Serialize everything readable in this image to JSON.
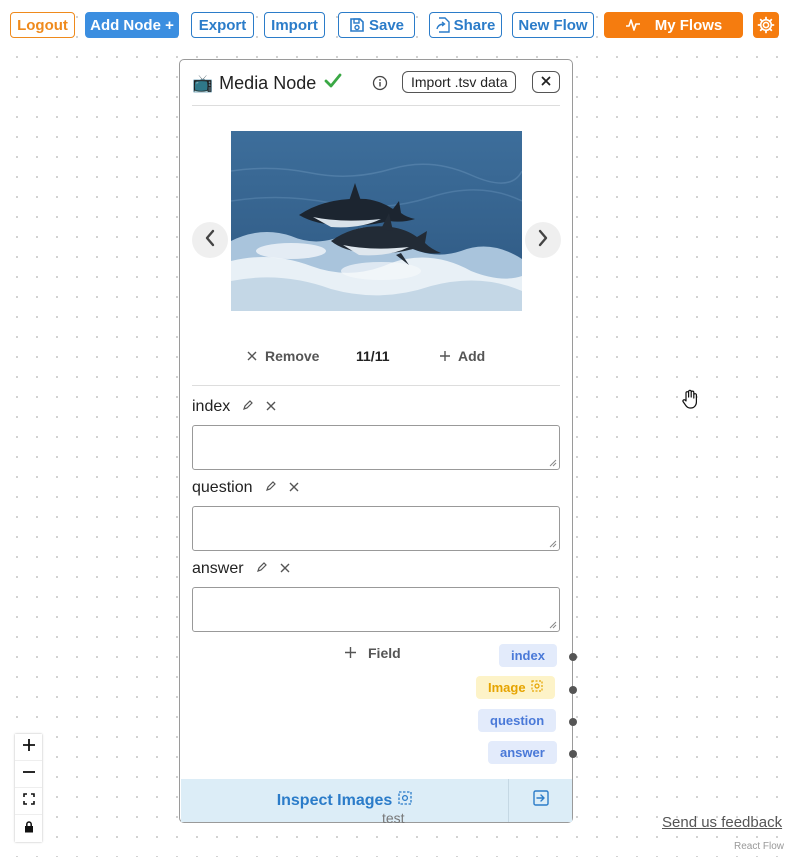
{
  "toolbar": {
    "logout": "Logout",
    "add_node": "Add Node +",
    "export": "Export",
    "import": "Import",
    "save": "Save",
    "share": "Share",
    "new_flow": "New Flow",
    "my_flows": "My Flows"
  },
  "node": {
    "title": "Media Node",
    "import_tsv": "Import .tsv data",
    "carousel": {
      "remove": "Remove",
      "counter": "11/11",
      "add": "Add"
    },
    "fields": [
      {
        "label": "index",
        "value": ""
      },
      {
        "label": "question",
        "value": ""
      },
      {
        "label": "answer",
        "value": ""
      }
    ],
    "add_field": "Field",
    "handles": [
      "index",
      "Image",
      "question",
      "answer"
    ],
    "inspect_label": "Inspect Images",
    "footer_text": "test"
  },
  "canvas": {
    "feedback": "Send us feedback",
    "attribution": "React Flow"
  },
  "colors": {
    "primary_blue": "#2b7cc9",
    "accent_orange": "#f57c0f",
    "tag_blue_bg": "#e3ebfb",
    "tag_yellow_bg": "#fdf3c8"
  }
}
